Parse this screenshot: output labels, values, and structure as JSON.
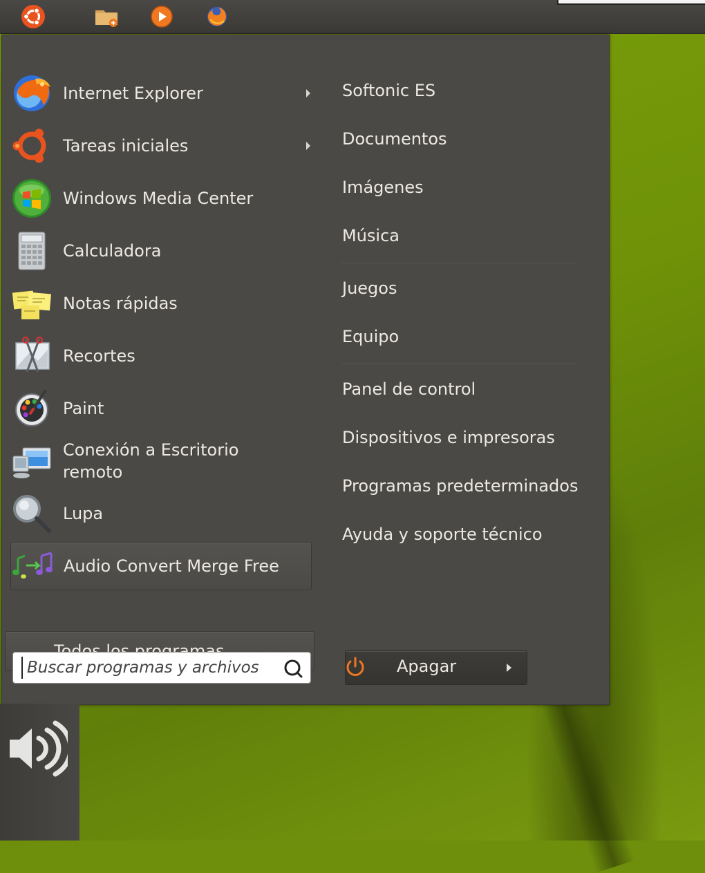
{
  "top_panel": {
    "icons": [
      "ubuntu-logo-icon",
      "folder-icon",
      "media-player-icon",
      "firefox-icon"
    ]
  },
  "left_items": [
    {
      "label": "Internet Explorer",
      "icon": "internet-explorer-icon",
      "has_submenu": true
    },
    {
      "label": "Tareas iniciales",
      "icon": "ubuntu-logo-icon",
      "has_submenu": true
    },
    {
      "label": "Windows Media Center",
      "icon": "windows-media-center-icon",
      "has_submenu": false
    },
    {
      "label": "Calculadora",
      "icon": "calculator-icon",
      "has_submenu": false
    },
    {
      "label": "Notas rápidas",
      "icon": "sticky-notes-icon",
      "has_submenu": false
    },
    {
      "label": "Recortes",
      "icon": "snipping-tool-icon",
      "has_submenu": false
    },
    {
      "label": "Paint",
      "icon": "paint-palette-icon",
      "has_submenu": false
    },
    {
      "label": "Conexión a Escritorio\nremoto",
      "icon": "remote-desktop-icon",
      "has_submenu": false
    },
    {
      "label": "Lupa",
      "icon": "magnifier-icon",
      "has_submenu": false
    },
    {
      "label": "Audio Convert Merge Free",
      "icon": "audio-music-notes-icon",
      "has_submenu": false
    }
  ],
  "all_programs_label": "Todos los programas",
  "search": {
    "placeholder": "Buscar programas y archivos",
    "value": ""
  },
  "right_items": [
    "Softonic ES",
    "Documentos",
    "Imágenes",
    "Música",
    "Juegos",
    "Equipo",
    "Panel de control",
    "Dispositivos e impresoras",
    "Programas predeterminados",
    "Ayuda y soporte técnico"
  ],
  "shutdown": {
    "label": "Apagar"
  },
  "colors": {
    "menu_bg": "#4b4945",
    "text": "#ece9e3",
    "accent_orange": "#f07820",
    "desktop_green": "#6e8f0c"
  }
}
